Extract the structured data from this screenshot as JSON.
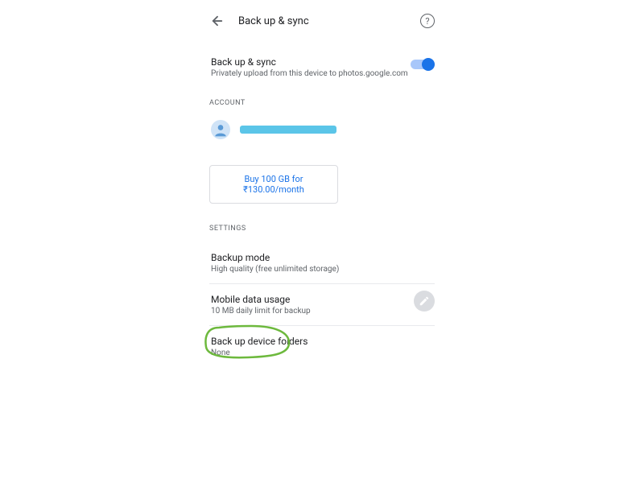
{
  "header": {
    "title": "Back up & sync"
  },
  "backup_toggle": {
    "title": "Back up & sync",
    "subtitle": "Privately upload from this device to photos.google.com",
    "enabled": true
  },
  "sections": {
    "account_label": "ACCOUNT",
    "settings_label": "SETTINGS"
  },
  "account": {
    "email_redacted": true
  },
  "buy_storage": {
    "label": "Buy 100 GB for ₹130.00/month"
  },
  "settings": {
    "backup_mode": {
      "title": "Backup mode",
      "subtitle": "High quality (free unlimited storage)"
    },
    "mobile_data": {
      "title": "Mobile data usage",
      "subtitle": "10 MB daily limit for backup"
    },
    "device_folders": {
      "title": "Back up device folders",
      "subtitle": "None"
    }
  },
  "annotation": {
    "highlight_color": "#6db93d"
  }
}
